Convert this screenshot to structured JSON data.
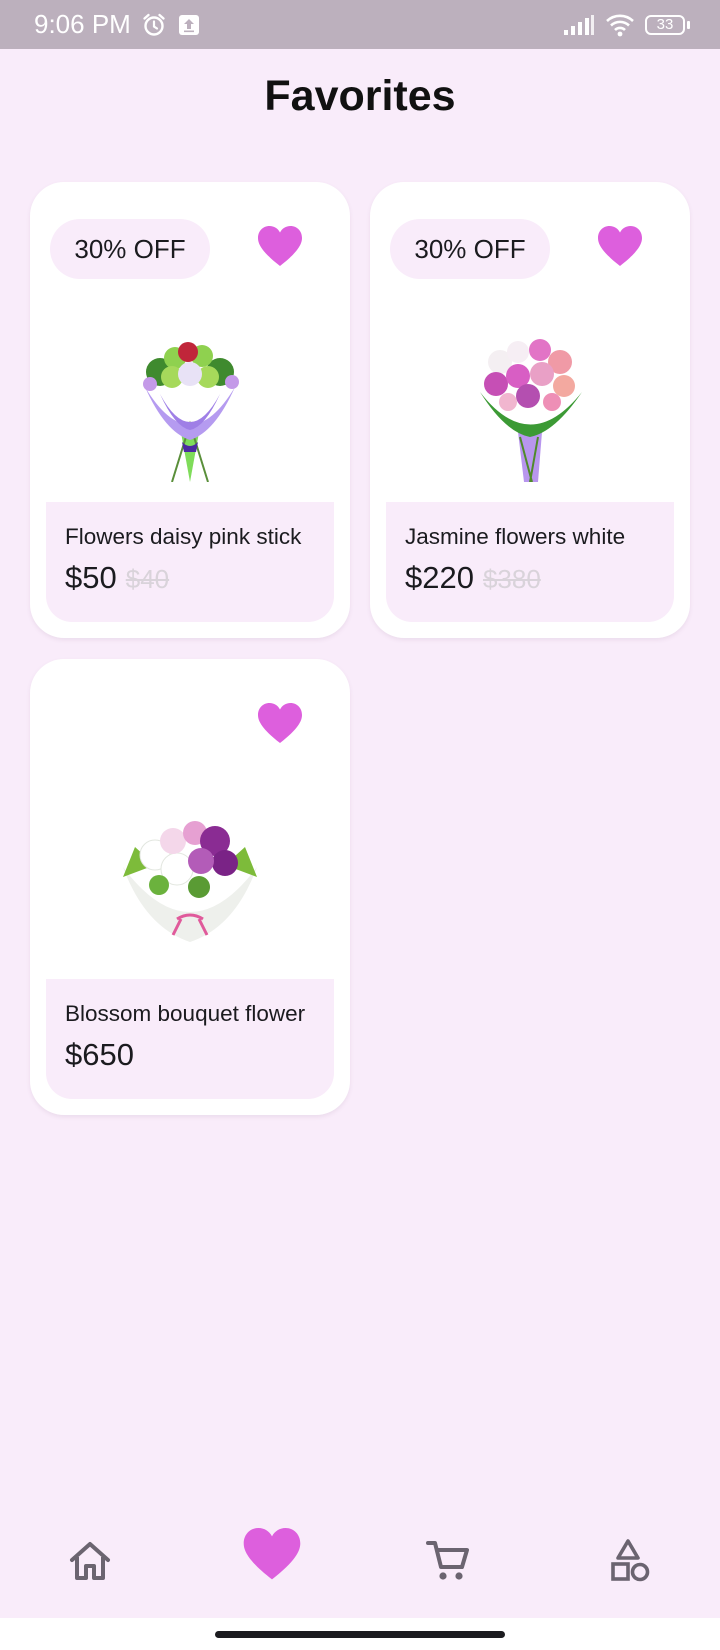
{
  "status_bar": {
    "time": "9:06 PM",
    "battery": "33",
    "icons": [
      "alarm-icon",
      "upload-icon",
      "signal-icon",
      "wifi-icon",
      "battery-icon"
    ]
  },
  "header": {
    "title": "Favorites"
  },
  "products": [
    {
      "name": "Flowers daisy pink stick",
      "price": "$50",
      "old_price": "$40",
      "discount": "30% OFF",
      "favorite": true
    },
    {
      "name": "Jasmine flowers white",
      "price": "$220",
      "old_price": "$380",
      "discount": "30% OFF",
      "favorite": true
    },
    {
      "name": "Blossom bouquet flower",
      "price": "$650",
      "old_price": "",
      "discount": "",
      "favorite": true
    }
  ],
  "bottom_nav": {
    "items": [
      "home-icon",
      "heart-icon",
      "cart-icon",
      "categories-icon"
    ],
    "active": "heart-icon"
  },
  "colors": {
    "accent": "#dd5fdd",
    "background": "#f9ecfa",
    "card": "#ffffff",
    "status_bar": "#bcb0bd",
    "icon_inactive": "#6b6470",
    "old_price": "#d9d3da"
  }
}
